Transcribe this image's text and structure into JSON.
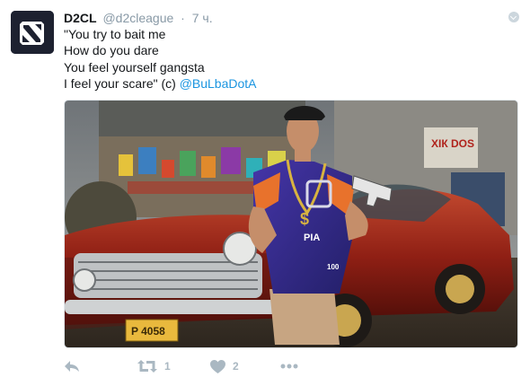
{
  "tweet": {
    "author": {
      "display_name": "D2CL",
      "handle": "@d2cleague",
      "avatar": "dota-logo-avatar"
    },
    "separator": "·",
    "time": "7 ч.",
    "text_lines": [
      "\"You try to bait me",
      "How do you dare",
      "You feel yourself gangsta"
    ],
    "last_line_prefix": "I feel your scare\" (c) ",
    "mention": "@BuLbaDotA",
    "media": {
      "description": "photo",
      "shirt_sponsor": "PIA",
      "shirt_number": "100",
      "wall_sign": "ХІК DOS",
      "plate": "P 4058"
    },
    "actions": {
      "reply": {
        "icon": "reply-icon"
      },
      "retweet": {
        "icon": "retweet-icon",
        "count": "1"
      },
      "like": {
        "icon": "heart-icon",
        "count": "2"
      },
      "more": {
        "icon": "more-icon"
      }
    },
    "colors": {
      "link": "#1b95e0",
      "meta": "#8899a6",
      "action": "#aab8c2"
    }
  }
}
